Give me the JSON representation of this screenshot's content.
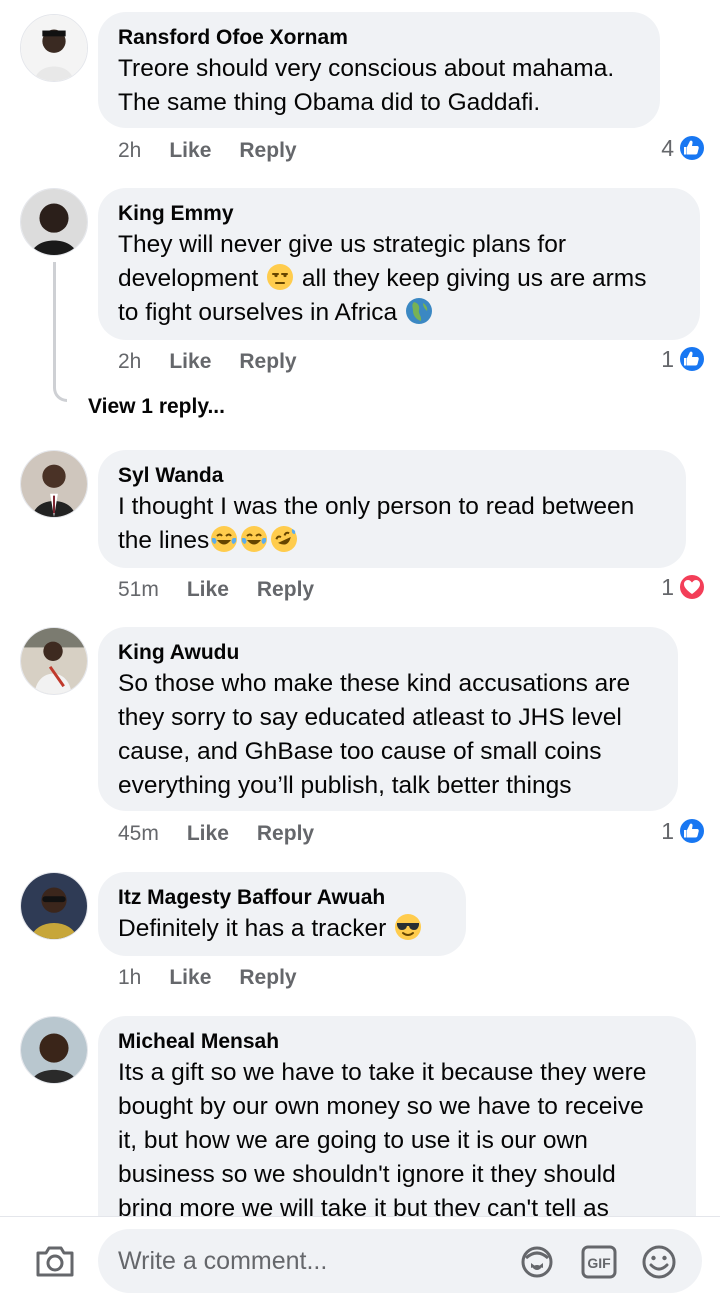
{
  "comments": [
    {
      "author": "Ransford Ofoe Xornam",
      "lines": [
        "Treore should very conscious about mahama.",
        "The same thing Obama did to Gaddafi."
      ],
      "time": "2h",
      "like": "Like",
      "reply": "Reply",
      "reaction_count": "4",
      "reaction_type": "like"
    },
    {
      "author": "King Emmy",
      "line1": "They will never give us strategic plans for",
      "line2a": "development ",
      "line2b": " all they keep giving us are arms",
      "line3": "to fight ourselves in Africa ",
      "time": "2h",
      "like": "Like",
      "reply": "Reply",
      "reaction_count": "1",
      "reaction_type": "like",
      "view_replies": "View 1 reply..."
    },
    {
      "author": "Syl Wanda",
      "line1": "I thought I was the only person to read between",
      "line2": "the lines",
      "time": "51m",
      "like": "Like",
      "reply": "Reply",
      "reaction_count": "1",
      "reaction_type": "love"
    },
    {
      "author": "King Awudu",
      "lines": [
        "So those who make these kind accusations are",
        "they sorry to say educated atleast to JHS level",
        "cause, and GhBase too cause of small coins",
        "everything you’ll publish, talk better things"
      ],
      "time": "45m",
      "like": "Like",
      "reply": "Reply",
      "reaction_count": "1",
      "reaction_type": "like"
    },
    {
      "author": "Itz Magesty Baffour Awuah",
      "line1": "Definitely it has a tracker ",
      "time": "1h",
      "like": "Like",
      "reply": "Reply"
    },
    {
      "author": "Micheal Mensah",
      "lines": [
        "Its a gift so we have to take it because they were",
        "bought by our own money so we have to receive",
        "it, but how we are going to use it is our own",
        "business so we shouldn't ignore it they should",
        "bring more we will take it but they can't tell as"
      ]
    }
  ],
  "composer": {
    "placeholder": "Write a comment...",
    "icons": [
      "camera-icon",
      "avatar-sticker-icon",
      "gif-icon",
      "emoji-icon"
    ]
  },
  "colors": {
    "like_blue": "#1877f2",
    "love_red": "#f33e58",
    "bubble": "#f0f2f5",
    "meta_gray": "#65676b"
  }
}
